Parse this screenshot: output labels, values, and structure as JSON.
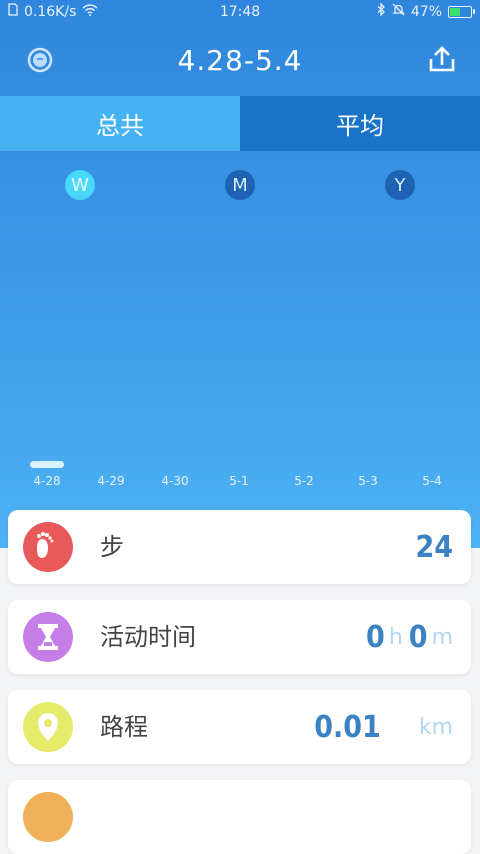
{
  "status_bar": {
    "network_speed": "0.16K/s",
    "time": "17:48",
    "battery": "47%",
    "battery_level": 0.47
  },
  "header": {
    "title": "4.28-5.4",
    "left_icon": "watch-icon",
    "right_icon": "share-icon"
  },
  "tabs": [
    "总共",
    "平均"
  ],
  "period_selector": [
    "W",
    "M",
    "Y"
  ],
  "chart_data": {
    "type": "bar",
    "categories": [
      "4-28",
      "4-29",
      "4-30",
      "5-1",
      "5-2",
      "5-3",
      "5-4"
    ],
    "values": [
      24,
      0,
      0,
      0,
      0,
      0,
      0
    ],
    "ylim": [
      0,
      10000
    ],
    "grid": false
  },
  "metrics": {
    "steps": {
      "label": "步",
      "value": "24",
      "icon": "footprint-icon",
      "color": "#e85a5a"
    },
    "active_time": {
      "label": "活动时间",
      "hours": "0",
      "hours_unit": "h",
      "minutes": "0",
      "minutes_unit": "m",
      "icon": "hourglass-icon",
      "color": "#c77de8"
    },
    "distance": {
      "label": "路程",
      "value": "0.01",
      "unit": "km",
      "icon": "location-pin-icon",
      "color": "#e6ea6a"
    }
  }
}
